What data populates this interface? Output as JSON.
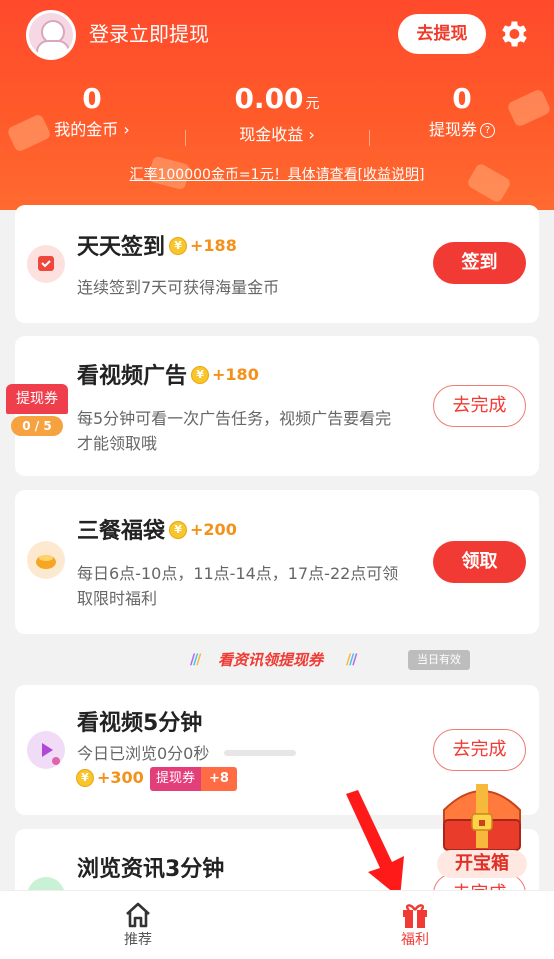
{
  "header": {
    "login_text": "登录立即提现",
    "withdraw_button": "去提现",
    "stats": [
      {
        "value": "0",
        "unit": "",
        "label": "我的金币",
        "suffix_icon": "chevron-right"
      },
      {
        "value": "0.00",
        "unit": "元",
        "label": "现金收益",
        "suffix_icon": "chevron-right"
      },
      {
        "value": "0",
        "unit": "",
        "label": "提现券",
        "suffix_icon": "question-circle"
      }
    ],
    "rate_note": "汇率100000金币=1元！具体请查看[收益说明]"
  },
  "tasks": [
    {
      "title": "天天签到",
      "reward": "+188",
      "desc": "连续签到7天可获得海量金币",
      "button": "签到",
      "button_style": "solid"
    },
    {
      "title": "看视频广告",
      "reward": "+180",
      "desc_line1": "每5分钟可看一次广告任务，视频广告要看完",
      "desc_line2": "才能领取哦",
      "button": "去完成",
      "button_style": "outline",
      "ticket_tag": "提现券",
      "ticket_count": "0 / 5"
    },
    {
      "title": "三餐福袋",
      "reward": "+200",
      "desc_line1": "每日6点-10点，11点-14点，17点-22点可领",
      "desc_line2": "取限时福利",
      "button": "领取",
      "button_style": "solid"
    }
  ],
  "section_banner": {
    "text": "看资讯领提现券",
    "badge": "当日有效"
  },
  "news_tasks": [
    {
      "title": "看视频5分钟",
      "progress_text": "今日已浏览0分0秒",
      "progress": 0,
      "coins": "+300",
      "ticket_label": "提现券",
      "ticket_count": "+8",
      "button": "去完成"
    },
    {
      "title": "浏览资讯3分钟",
      "button": "去完成"
    }
  ],
  "treasure": {
    "label": "开宝箱"
  },
  "bottom_nav": [
    {
      "label": "推荐",
      "icon": "home-icon",
      "active": false
    },
    {
      "label": "福利",
      "icon": "gift-icon",
      "active": true
    }
  ],
  "colors": {
    "accent": "#f03a33",
    "header": "#ff5a2a",
    "coin": "#f8c52a",
    "reward": "#f3911b"
  }
}
